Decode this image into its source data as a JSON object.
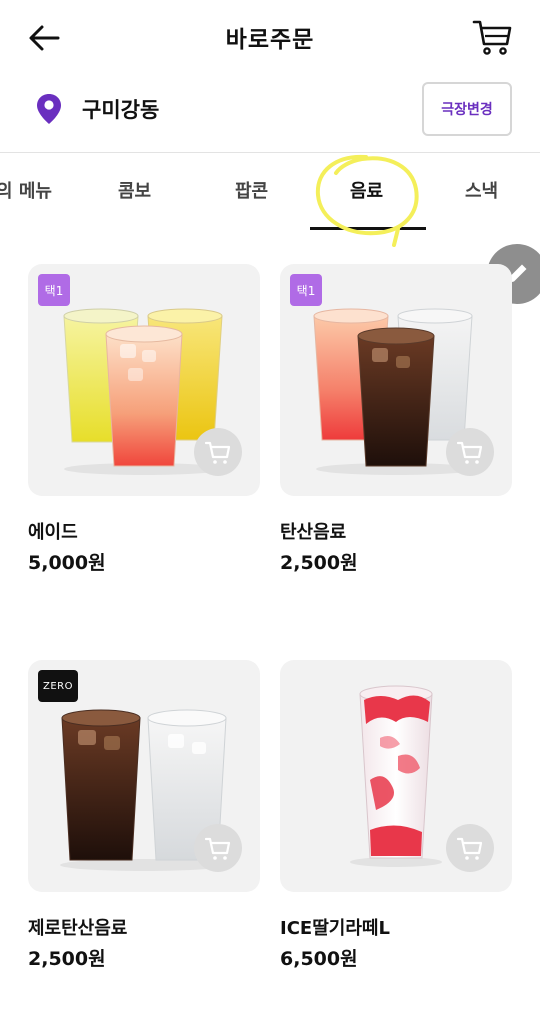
{
  "header": {
    "title": "바로주문"
  },
  "theater": {
    "name": "구미강동",
    "change_label": "극장변경"
  },
  "tabs": [
    {
      "label": "의 메뉴"
    },
    {
      "label": "콤보"
    },
    {
      "label": "팝콘"
    },
    {
      "label": "음료",
      "active": true
    },
    {
      "label": "스낵"
    }
  ],
  "products": [
    {
      "name": "에이드",
      "price": "5,000원",
      "badge": "택1"
    },
    {
      "name": "탄산음료",
      "price": "2,500원",
      "badge": "택1"
    },
    {
      "name": "제로탄산음료",
      "price": "2,500원",
      "badge": "ZERO"
    },
    {
      "name": "ICE딸기라떼L",
      "price": "6,500원",
      "badge": ""
    }
  ],
  "colors": {
    "accent": "#6a2fbf",
    "badge_purple": "#b06be6",
    "highlight": "#f4ef5a"
  }
}
